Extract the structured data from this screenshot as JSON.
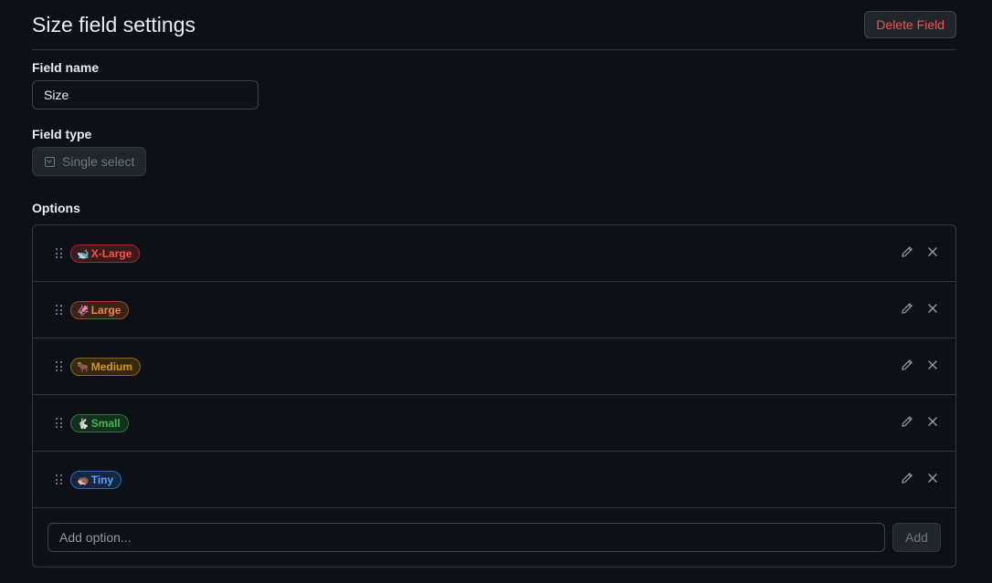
{
  "header": {
    "title": "Size field settings",
    "delete_label": "Delete Field"
  },
  "field_name": {
    "label": "Field name",
    "value": "Size"
  },
  "field_type": {
    "label": "Field type",
    "value": "Single select"
  },
  "options": {
    "label": "Options",
    "items": [
      {
        "emoji": "🐋",
        "label": "X-Large",
        "color": "#f85149",
        "bg": "#3b1a1d",
        "border": "#a5282f"
      },
      {
        "emoji": "🦑",
        "label": "Large",
        "color": "#f0883e",
        "bg": "#3a2318",
        "border": "#9b4a24"
      },
      {
        "emoji": "🐂",
        "label": "Medium",
        "color": "#d29922",
        "bg": "#36290f",
        "border": "#8a6418"
      },
      {
        "emoji": "🐇",
        "label": "Small",
        "color": "#3fb950",
        "bg": "#12301d",
        "border": "#2b7a3a"
      },
      {
        "emoji": "🦔",
        "label": "Tiny",
        "color": "#58a6ff",
        "bg": "#142640",
        "border": "#2f67b4"
      }
    ],
    "add_placeholder": "Add option...",
    "add_label": "Add"
  }
}
